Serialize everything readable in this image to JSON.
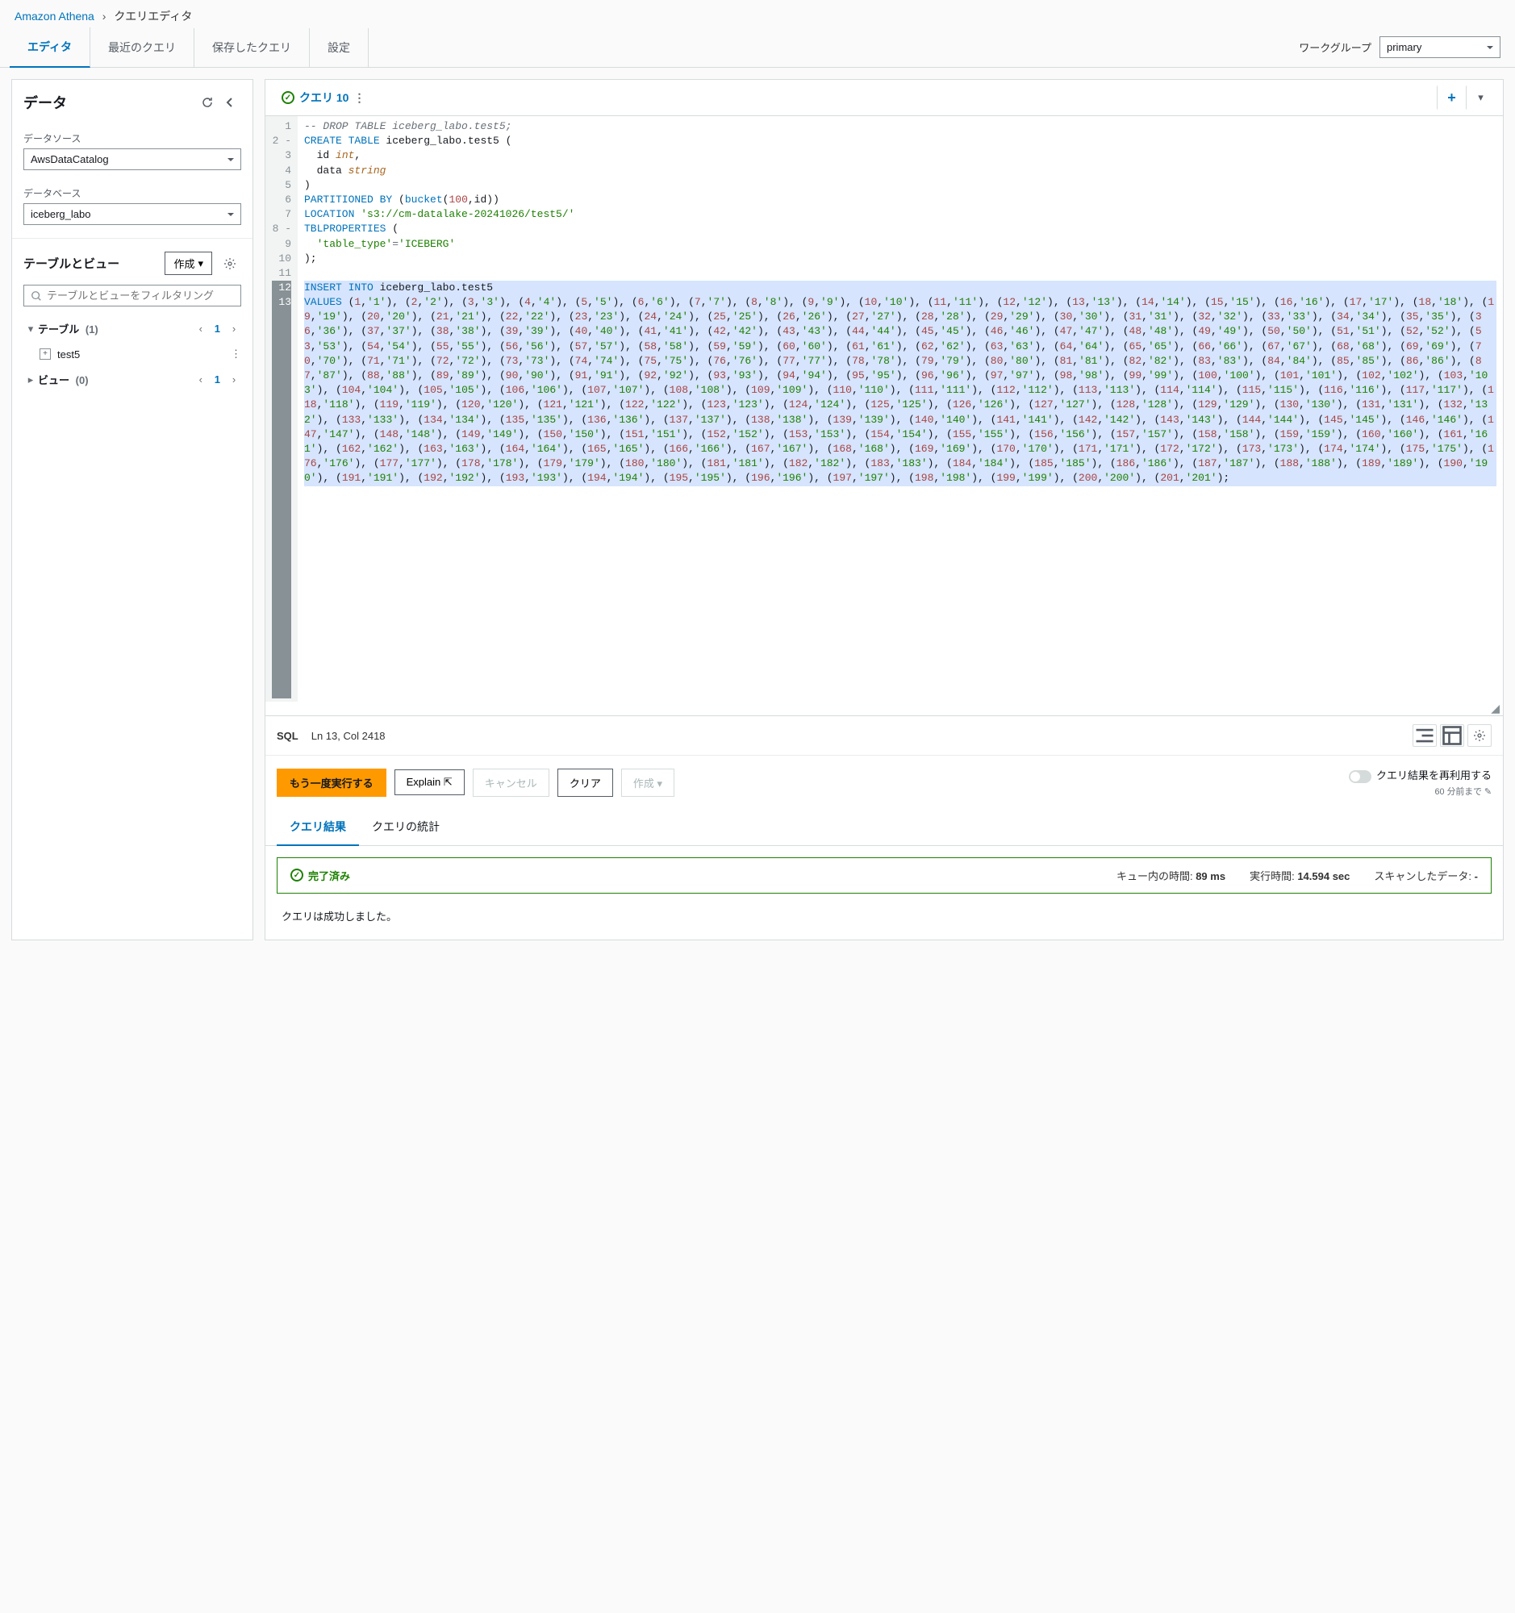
{
  "breadcrumb": {
    "root": "Amazon Athena",
    "current": "クエリエディタ"
  },
  "tabs": {
    "editor": "エディタ",
    "recent": "最近のクエリ",
    "saved": "保存したクエリ",
    "settings": "設定"
  },
  "workgroup": {
    "label": "ワークグループ",
    "value": "primary"
  },
  "sidebar": {
    "title": "データ",
    "datasource_label": "データソース",
    "datasource_value": "AwsDataCatalog",
    "database_label": "データベース",
    "database_value": "iceberg_labo",
    "tv_title": "テーブルとビュー",
    "create_btn": "作成",
    "search_placeholder": "テーブルとビューをフィルタリング",
    "tables_label": "テーブル",
    "tables_count": "(1)",
    "table_item": "test5",
    "views_label": "ビュー",
    "views_count": "(0)",
    "page": "1"
  },
  "editor_tab": {
    "label": "クエリ 10"
  },
  "code": {
    "lines": [
      {
        "n": 1,
        "fold": "",
        "segs": [
          {
            "t": "-- DROP TABLE iceberg_labo.test5;",
            "c": "c-comment"
          }
        ]
      },
      {
        "n": 2,
        "fold": "-",
        "segs": [
          {
            "t": "CREATE TABLE ",
            "c": "c-kw"
          },
          {
            "t": "iceberg_labo.test5 ("
          }
        ]
      },
      {
        "n": 3,
        "fold": "",
        "segs": [
          {
            "t": "  id "
          },
          {
            "t": "int",
            "c": "c-type"
          },
          {
            "t": ","
          }
        ]
      },
      {
        "n": 4,
        "fold": "",
        "segs": [
          {
            "t": "  data "
          },
          {
            "t": "string",
            "c": "c-type"
          }
        ]
      },
      {
        "n": 5,
        "fold": "",
        "segs": [
          {
            "t": ")"
          }
        ]
      },
      {
        "n": 6,
        "fold": "",
        "segs": [
          {
            "t": "PARTITIONED BY ",
            "c": "c-kw"
          },
          {
            "t": "("
          },
          {
            "t": "bucket",
            "c": "c-fn"
          },
          {
            "t": "("
          },
          {
            "t": "100",
            "c": "c-num"
          },
          {
            "t": ",id))"
          }
        ]
      },
      {
        "n": 7,
        "fold": "",
        "segs": [
          {
            "t": "LOCATION ",
            "c": "c-kw"
          },
          {
            "t": "'s3://cm-datalake-20241026/test5/'",
            "c": "c-str"
          }
        ]
      },
      {
        "n": 8,
        "fold": "-",
        "segs": [
          {
            "t": "TBLPROPERTIES ",
            "c": "c-kw"
          },
          {
            "t": "("
          }
        ]
      },
      {
        "n": 9,
        "fold": "",
        "segs": [
          {
            "t": "  'table_type'",
            "c": "c-str"
          },
          {
            "t": "=",
            "c": "c-op"
          },
          {
            "t": "'ICEBERG'",
            "c": "c-str"
          }
        ]
      },
      {
        "n": 10,
        "fold": "",
        "segs": [
          {
            "t": ");"
          }
        ]
      },
      {
        "n": 11,
        "fold": "",
        "segs": [
          {
            "t": ""
          }
        ]
      },
      {
        "n": 12,
        "fold": "",
        "sel": true,
        "segs": [
          {
            "t": "INSERT INTO ",
            "c": "c-kw"
          },
          {
            "t": "iceberg_labo.test5"
          }
        ]
      },
      {
        "n": 13,
        "fold": "",
        "sel": true,
        "wrap": true
      }
    ],
    "values_start": 1,
    "values_end": 201,
    "values_prefix": "VALUES "
  },
  "status": {
    "lang": "SQL",
    "pos": "Ln 13, Col 2418"
  },
  "actions": {
    "run": "もう一度実行する",
    "explain": "Explain",
    "cancel": "キャンセル",
    "clear": "クリア",
    "create": "作成",
    "reuse_label": "クエリ結果を再利用する",
    "reuse_sub": "60 分前まで"
  },
  "results": {
    "tab_result": "クエリ結果",
    "tab_stats": "クエリの統計",
    "status": "完了済み",
    "queue_label": "キュー内の時間:",
    "queue_val": "89 ms",
    "run_label": "実行時間:",
    "run_val": "14.594 sec",
    "scan_label": "スキャンしたデータ:",
    "scan_val": "-",
    "message": "クエリは成功しました。"
  }
}
